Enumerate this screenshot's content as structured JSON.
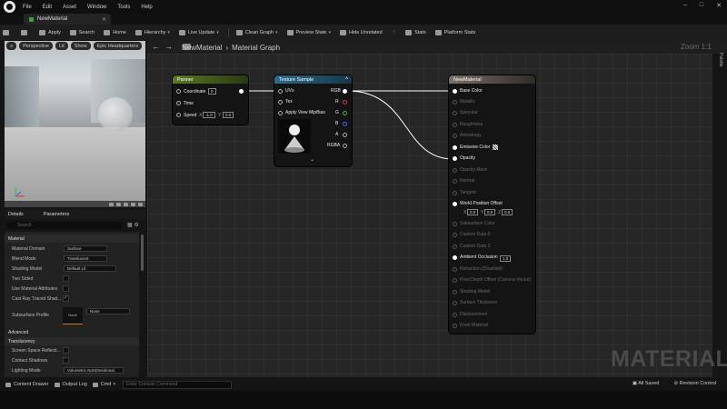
{
  "menu": [
    "File",
    "Edit",
    "Asset",
    "Window",
    "Tools",
    "Help"
  ],
  "window_controls": [
    "–",
    "□",
    "✕"
  ],
  "tab": {
    "title": "NewMaterial"
  },
  "toolbar": [
    {
      "label": "",
      "icon": "save-icon"
    },
    {
      "label": "",
      "icon": "browse-icon"
    },
    {
      "label": "Apply",
      "icon": "apply-icon"
    },
    {
      "label": "Search",
      "icon": "search-icon"
    },
    {
      "label": "Home",
      "icon": "home-icon"
    },
    {
      "label": "Hierarchy",
      "icon": "hierarchy-icon",
      "dropdown": true
    },
    {
      "label": "Live Update",
      "icon": "live-update-icon",
      "dropdown": true
    },
    {
      "label": "Clean Graph",
      "icon": "clean-graph-icon",
      "dropdown": true
    },
    {
      "label": "Preview State",
      "icon": "preview-state-icon",
      "dropdown": true
    },
    {
      "label": "Hide Unrelated",
      "icon": "hide-unrelated-icon"
    },
    {
      "label": "Stats",
      "icon": "stats-icon"
    },
    {
      "label": "Platform Stats",
      "icon": "platform-stats-icon"
    }
  ],
  "viewport": {
    "buttons": [
      "Perspective",
      "Lit",
      "Show",
      "Epic Headquarters"
    ]
  },
  "details": {
    "tabs": [
      "Details",
      "Parameters"
    ],
    "search_placeholder": "Search",
    "sections": {
      "material": "Material",
      "advanced": "Advanced",
      "translucency": "Translucency"
    },
    "props": {
      "material_domain": {
        "label": "Material Domain",
        "value": "Surface"
      },
      "blend_mode": {
        "label": "Blend Mode",
        "value": "Translucent"
      },
      "shading_model": {
        "label": "Shading Model",
        "value": "Default Lit"
      },
      "two_sided": {
        "label": "Two Sided",
        "checked": false
      },
      "use_material_attributes": {
        "label": "Use Material Attributes",
        "checked": false
      },
      "cast_ray_traced": {
        "label": "Cast Ray Traced Shad...",
        "checked": true
      },
      "subsurface_profile": {
        "label": "Subsurface Profile",
        "value": "None",
        "thumb": "None"
      },
      "screen_space_reflect": {
        "label": "Screen Space Reflecti...",
        "checked": false
      },
      "contact_shadows": {
        "label": "Contact Shadows",
        "checked": false
      },
      "lighting_mode": {
        "label": "Lighting Mode",
        "value": "Volumetric NonDirectional"
      }
    }
  },
  "graph": {
    "breadcrumb": [
      "NewMaterial",
      "›",
      "Material Graph"
    ],
    "zoom": "Zoom 1:1",
    "palette": "Palette",
    "watermark": "MATERIAL"
  },
  "nodes": {
    "panner": {
      "title": "Panner",
      "color": "#6b8f2a",
      "inputs": [
        "Coordinate",
        "Time",
        "Speed"
      ],
      "coord_value": "0",
      "speed_x_label": "X",
      "speed_x": "-1.0",
      "speed_y_label": "Y",
      "speed_y": "0.0"
    },
    "texture": {
      "title": "Texture Sample",
      "color": "#2d6b8a",
      "inputs": [
        "UVs",
        "Tex",
        "Apply View MipBias"
      ],
      "outputs": [
        "RGB",
        "R",
        "G",
        "B",
        "A",
        "RGBA"
      ],
      "output_colors": [
        "#ffffff",
        "#e03030",
        "#30c030",
        "#4060ff",
        "#dddddd",
        "#ffffff"
      ]
    },
    "material": {
      "title": "NewMaterial",
      "color": "#7a7066",
      "pins": [
        {
          "label": "Base Color",
          "active": true
        },
        {
          "label": "Metallic",
          "active": false
        },
        {
          "label": "Specular",
          "active": false
        },
        {
          "label": "Roughness",
          "active": false
        },
        {
          "label": "Anisotropy",
          "active": false
        },
        {
          "label": "Emissive Color",
          "active": true
        },
        {
          "label": "Opacity",
          "active": true
        },
        {
          "label": "Opacity Mask",
          "active": false
        },
        {
          "label": "Normal",
          "active": false
        },
        {
          "label": "Tangent",
          "active": false
        },
        {
          "label": "World Position Offset",
          "active": true
        },
        {
          "label": "Subsurface Color",
          "active": false
        },
        {
          "label": "Custom Data 0",
          "active": false
        },
        {
          "label": "Custom Data 1",
          "active": false
        },
        {
          "label": "Ambient Occlusion",
          "active": true
        },
        {
          "label": "Refraction (Disabled)",
          "active": false
        },
        {
          "label": "Pixel Depth Offset (Camera Vector)",
          "active": false
        },
        {
          "label": "Shading Model",
          "active": false
        },
        {
          "label": "Surface Thickness",
          "active": false
        },
        {
          "label": "Displacement",
          "active": false
        },
        {
          "label": "Front Material",
          "active": false
        }
      ],
      "wpo_x_label": "X",
      "wpo_x": "0.0",
      "wpo_y_label": "Y",
      "wpo_y": "0.0",
      "wpo_z_label": "Z",
      "wpo_z": "0.0",
      "ao_value": "1.0"
    }
  },
  "bottombar": {
    "content_drawer": "Content Drawer",
    "output_log": "Output Log",
    "cmd": "Cmd",
    "console_placeholder": "Enter Console Command",
    "saved": "All Saved",
    "revision": "Revision Control"
  }
}
